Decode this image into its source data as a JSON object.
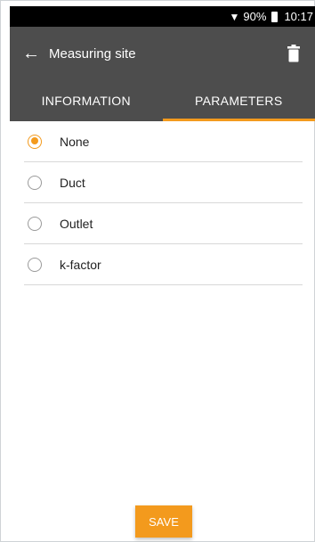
{
  "status_bar": {
    "battery": "90%",
    "time": "10:17"
  },
  "app_bar": {
    "title": "Measuring site",
    "back_icon": "arrow-left-icon",
    "delete_icon": "trash-icon"
  },
  "tabs": [
    {
      "label": "INFORMATION",
      "active": false
    },
    {
      "label": "PARAMETERS",
      "active": true
    }
  ],
  "options": [
    {
      "label": "None",
      "selected": true
    },
    {
      "label": "Duct",
      "selected": false
    },
    {
      "label": "Outlet",
      "selected": false
    },
    {
      "label": "k-factor",
      "selected": false
    }
  ],
  "save_label": "SAVE",
  "colors": {
    "accent": "#f39a1d",
    "header": "#4d4d4d",
    "status_bar": "#000000"
  }
}
